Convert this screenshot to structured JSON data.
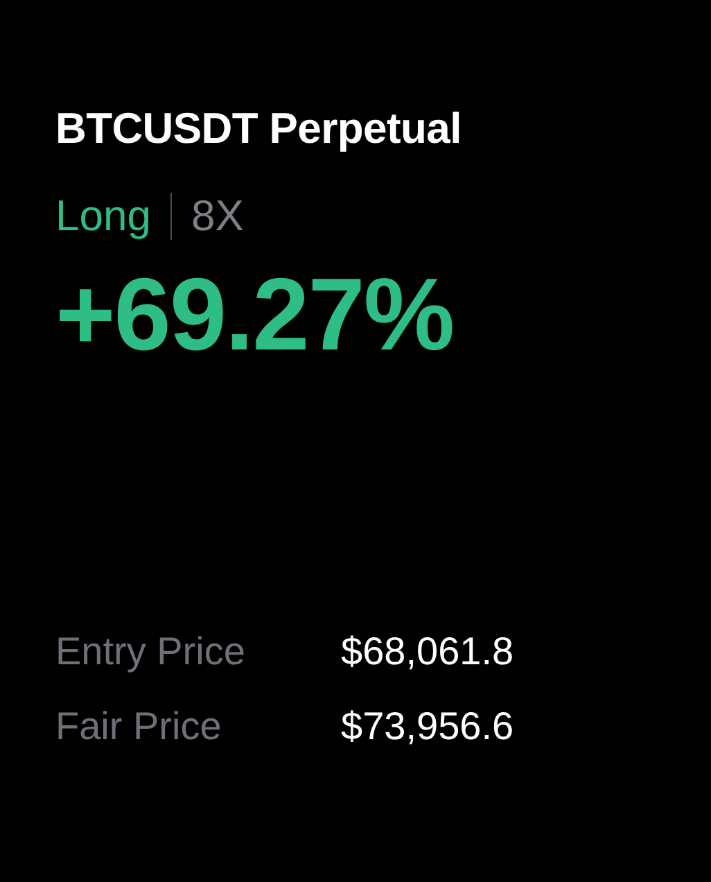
{
  "position": {
    "symbol": "BTCUSDT Perpetual",
    "side": "Long",
    "leverage": "8X",
    "pnl_percent": "+69.27%"
  },
  "prices": [
    {
      "label": "Entry Price",
      "value": "$68,061.8"
    },
    {
      "label": "Fair Price",
      "value": "$73,956.6"
    }
  ]
}
